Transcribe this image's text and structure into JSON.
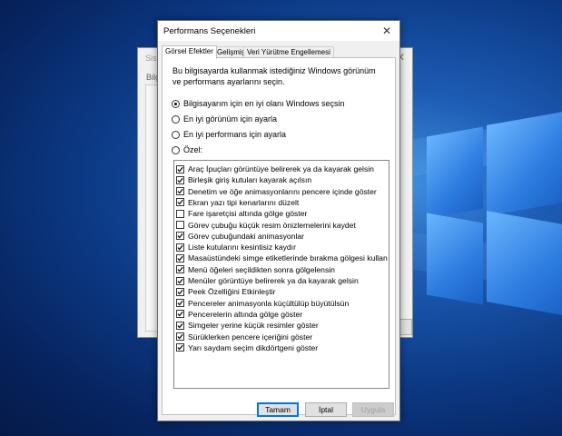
{
  "background_dialog": {
    "title": "Siste",
    "tab": "Bilg"
  },
  "dialog": {
    "title": "Performans Seçenekleri",
    "close_label": "✕",
    "tabs": [
      {
        "label": "Görsel Efektler",
        "active": true
      },
      {
        "label": "Gelişmiş",
        "active": false
      },
      {
        "label": "Veri Yürütme Engellemesi",
        "active": false
      }
    ],
    "description": "Bu bilgisayarda kullanmak istediğiniz Windows görünüm ve performans ayarlarını seçin.",
    "radios": [
      {
        "label": "Bilgisayarım için en iyi olanı Windows seçsin",
        "selected": true
      },
      {
        "label": "En iyi görünüm için ayarla",
        "selected": false
      },
      {
        "label": "En iyi performans için ayarla",
        "selected": false
      },
      {
        "label": "Özel:",
        "selected": false
      }
    ],
    "effects": [
      {
        "label": "Araç İpuçları görüntüye belirerek ya da kayarak gelsin",
        "checked": true
      },
      {
        "label": "Birleşik giriş kutuları kayarak açılsın",
        "checked": true
      },
      {
        "label": "Denetim ve öğe animasyonlarını pencere içinde göster",
        "checked": true
      },
      {
        "label": "Ekran yazı tipi kenarlarını düzelt",
        "checked": true
      },
      {
        "label": "Fare işaretçisi altında gölge göster",
        "checked": false
      },
      {
        "label": "Görev çubuğu küçük resim önizlemelerini kaydet",
        "checked": false
      },
      {
        "label": "Görev çubuğundaki animasyonlar",
        "checked": true
      },
      {
        "label": "Liste kutularını kesintisiz kaydır",
        "checked": true
      },
      {
        "label": "Masaüstündeki simge etiketlerinde bırakma gölgesi kullan",
        "checked": true
      },
      {
        "label": "Menü öğeleri seçildikten sonra gölgelensin",
        "checked": true
      },
      {
        "label": "Menüler görüntüye belirerek ya da kayarak gelsin",
        "checked": true
      },
      {
        "label": "Peek Özelliğini Etkinleştir",
        "checked": true
      },
      {
        "label": "Pencereler animasyonla küçültülüp büyütülsün",
        "checked": true
      },
      {
        "label": "Pencerelerin altında gölge göster",
        "checked": true
      },
      {
        "label": "Simgeler yerine küçük resimler göster",
        "checked": true
      },
      {
        "label": "Sürüklerken pencere içeriğini göster",
        "checked": true
      },
      {
        "label": "Yarı saydam seçim dikdörtgeni göster",
        "checked": true
      }
    ],
    "buttons": {
      "ok": "Tamam",
      "cancel": "İptal",
      "apply": "Uygula"
    }
  },
  "colors": {
    "desktop": "#0c3a86",
    "accent": "#0078d7",
    "dialog_bg": "#f0f0f0"
  }
}
